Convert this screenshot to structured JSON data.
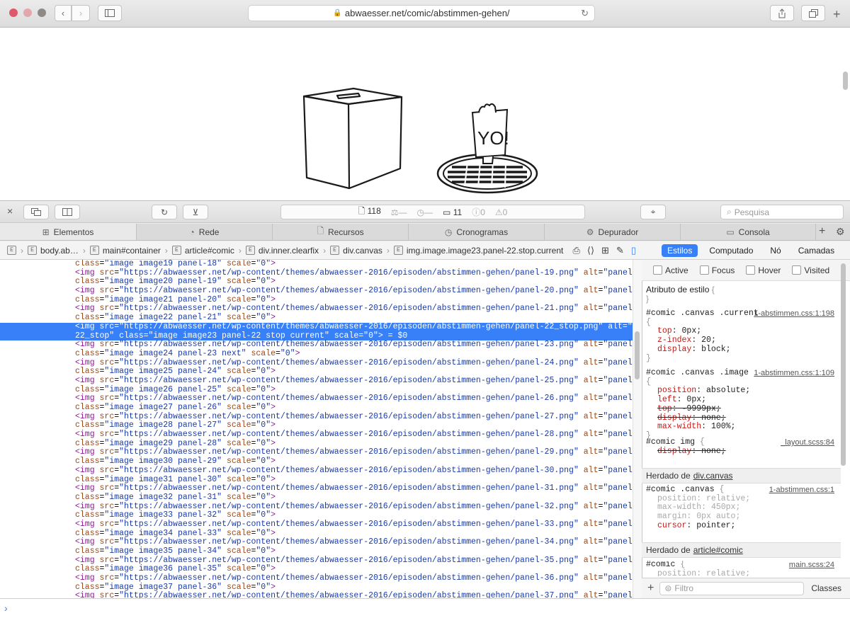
{
  "browser": {
    "url": "abwaesser.net/comic/abstimmen-gehen/",
    "traffic_lights": [
      "#e0596a",
      "#e3a6ac",
      "#8f8a86"
    ]
  },
  "comic": {
    "sign_text": "YO!"
  },
  "toolbar": {
    "resource_count": "118",
    "size": "—",
    "time": "—",
    "logs": "11",
    "errors": "0",
    "warnings": "0",
    "search_placeholder": "Pesquisa"
  },
  "tabs": [
    {
      "label": "Elementos",
      "icon": "elements-icon"
    },
    {
      "label": "Rede",
      "icon": "network-icon"
    },
    {
      "label": "Recursos",
      "icon": "resources-icon"
    },
    {
      "label": "Cronogramas",
      "icon": "timelines-icon"
    },
    {
      "label": "Depurador",
      "icon": "debugger-icon"
    },
    {
      "label": "Consola",
      "icon": "console-icon"
    }
  ],
  "breadcrumb": [
    "body.ab…",
    "main#container",
    "article#comic",
    "div.inner.clearfix",
    "div.canvas",
    "img.image.image23.panel-22.stop.current"
  ],
  "dom_lines": [
    {
      "kind": "class",
      "cls": "image image19 panel-18",
      "scale": "0"
    },
    {
      "kind": "img",
      "src": "https://abwaesser.net/wp-content/themes/abwaesser-2016/episoden/abstimmen-gehen/panel-19.png",
      "alt": "panel-19"
    },
    {
      "kind": "class",
      "cls": "image image20 panel-19",
      "scale": "0"
    },
    {
      "kind": "img",
      "src": "https://abwaesser.net/wp-content/themes/abwaesser-2016/episoden/abstimmen-gehen/panel-20.png",
      "alt": "panel-20"
    },
    {
      "kind": "class",
      "cls": "image image21 panel-20",
      "scale": "0"
    },
    {
      "kind": "img",
      "src": "https://abwaesser.net/wp-content/themes/abwaesser-2016/episoden/abstimmen-gehen/panel-21.png",
      "alt": "panel-21"
    },
    {
      "kind": "class",
      "cls": "image image22 panel-21",
      "scale": "0"
    },
    {
      "kind": "sel1",
      "text": "<img src=\"https://abwaesser.net/wp-content/themes/abwaesser-2016/episoden/abstimmen-gehen/panel-22_stop.png\" alt=\"panel-"
    },
    {
      "kind": "sel2",
      "text": "22_stop\" class=\"image image23 panel-22 stop current\" scale=\"0\"> = $0"
    },
    {
      "kind": "img",
      "src": "https://abwaesser.net/wp-content/themes/abwaesser-2016/episoden/abstimmen-gehen/panel-23.png",
      "alt": "panel-23"
    },
    {
      "kind": "class",
      "cls": "image image24 panel-23 next",
      "scale": "0"
    },
    {
      "kind": "img",
      "src": "https://abwaesser.net/wp-content/themes/abwaesser-2016/episoden/abstimmen-gehen/panel-24.png",
      "alt": "panel-24"
    },
    {
      "kind": "class",
      "cls": "image image25 panel-24",
      "scale": "0"
    },
    {
      "kind": "img",
      "src": "https://abwaesser.net/wp-content/themes/abwaesser-2016/episoden/abstimmen-gehen/panel-25.png",
      "alt": "panel-25"
    },
    {
      "kind": "class",
      "cls": "image image26 panel-25",
      "scale": "0"
    },
    {
      "kind": "img",
      "src": "https://abwaesser.net/wp-content/themes/abwaesser-2016/episoden/abstimmen-gehen/panel-26.png",
      "alt": "panel-26"
    },
    {
      "kind": "class",
      "cls": "image image27 panel-26",
      "scale": "0"
    },
    {
      "kind": "img",
      "src": "https://abwaesser.net/wp-content/themes/abwaesser-2016/episoden/abstimmen-gehen/panel-27.png",
      "alt": "panel-27"
    },
    {
      "kind": "class",
      "cls": "image image28 panel-27",
      "scale": "0"
    },
    {
      "kind": "img",
      "src": "https://abwaesser.net/wp-content/themes/abwaesser-2016/episoden/abstimmen-gehen/panel-28.png",
      "alt": "panel-28"
    },
    {
      "kind": "class",
      "cls": "image image29 panel-28",
      "scale": "0"
    },
    {
      "kind": "img",
      "src": "https://abwaesser.net/wp-content/themes/abwaesser-2016/episoden/abstimmen-gehen/panel-29.png",
      "alt": "panel-29"
    },
    {
      "kind": "class",
      "cls": "image image30 panel-29",
      "scale": "0"
    },
    {
      "kind": "img",
      "src": "https://abwaesser.net/wp-content/themes/abwaesser-2016/episoden/abstimmen-gehen/panel-30.png",
      "alt": "panel-30"
    },
    {
      "kind": "class",
      "cls": "image image31 panel-30",
      "scale": "0"
    },
    {
      "kind": "img",
      "src": "https://abwaesser.net/wp-content/themes/abwaesser-2016/episoden/abstimmen-gehen/panel-31.png",
      "alt": "panel-31"
    },
    {
      "kind": "class",
      "cls": "image image32 panel-31",
      "scale": "0"
    },
    {
      "kind": "img",
      "src": "https://abwaesser.net/wp-content/themes/abwaesser-2016/episoden/abstimmen-gehen/panel-32.png",
      "alt": "panel-32"
    },
    {
      "kind": "class",
      "cls": "image image33 panel-32",
      "scale": "0"
    },
    {
      "kind": "img",
      "src": "https://abwaesser.net/wp-content/themes/abwaesser-2016/episoden/abstimmen-gehen/panel-33.png",
      "alt": "panel-33"
    },
    {
      "kind": "class",
      "cls": "image image34 panel-33",
      "scale": "0"
    },
    {
      "kind": "img",
      "src": "https://abwaesser.net/wp-content/themes/abwaesser-2016/episoden/abstimmen-gehen/panel-34.png",
      "alt": "panel-34"
    },
    {
      "kind": "class",
      "cls": "image image35 panel-34",
      "scale": "0"
    },
    {
      "kind": "img",
      "src": "https://abwaesser.net/wp-content/themes/abwaesser-2016/episoden/abstimmen-gehen/panel-35.png",
      "alt": "panel-35"
    },
    {
      "kind": "class",
      "cls": "image image36 panel-35",
      "scale": "0"
    },
    {
      "kind": "img",
      "src": "https://abwaesser.net/wp-content/themes/abwaesser-2016/episoden/abstimmen-gehen/panel-36.png",
      "alt": "panel-36"
    },
    {
      "kind": "class",
      "cls": "image image37 panel-36",
      "scale": "0"
    },
    {
      "kind": "img",
      "src": "https://abwaesser.net/wp-content/themes/abwaesser-2016/episoden/abstimmen-gehen/panel-37.png",
      "alt": "panel-37"
    }
  ],
  "sidebar": {
    "tabs": [
      "Estilos",
      "Computado",
      "Nó",
      "Camadas"
    ],
    "pseudo": [
      "Active",
      "Focus",
      "Hover",
      "Visited"
    ],
    "style_attr": "Atributo de estilo",
    "rules": [
      {
        "selector": "#comic .canvas .current",
        "source": "1-abstimmen.css:1:198",
        "props": [
          [
            "top",
            "0px"
          ],
          [
            "z-index",
            "20"
          ],
          [
            "display",
            "block"
          ]
        ]
      },
      {
        "selector": "#comic .canvas .image",
        "source": "1-abstimmen.css:1:109",
        "props": [
          [
            "position",
            "absolute"
          ],
          [
            "left",
            "0px"
          ],
          [
            "top",
            "-9999px"
          ],
          [
            "display",
            "none"
          ],
          [
            "max-width",
            "100%"
          ]
        ]
      },
      {
        "selector": "#comic img",
        "source": "_layout.scss:84",
        "props": [
          [
            "display",
            "none"
          ]
        ]
      }
    ],
    "inherited_label": "Herdado de",
    "inherited": [
      {
        "from": "div.canvas",
        "selector": "#comic .canvas",
        "source": "1-abstimmen.css:1",
        "props": [
          [
            "position",
            "relative"
          ],
          [
            "max-width",
            "450px"
          ],
          [
            "margin",
            "0px auto"
          ],
          [
            "cursor",
            "pointer"
          ]
        ]
      },
      {
        "from": "article#comic",
        "selector": "#comic",
        "source": "main.scss:24",
        "props": [
          [
            "position",
            "relative"
          ]
        ]
      }
    ],
    "filter_placeholder": "Filtro",
    "classes_label": "Classes"
  },
  "console": {
    "prompt": "›"
  }
}
